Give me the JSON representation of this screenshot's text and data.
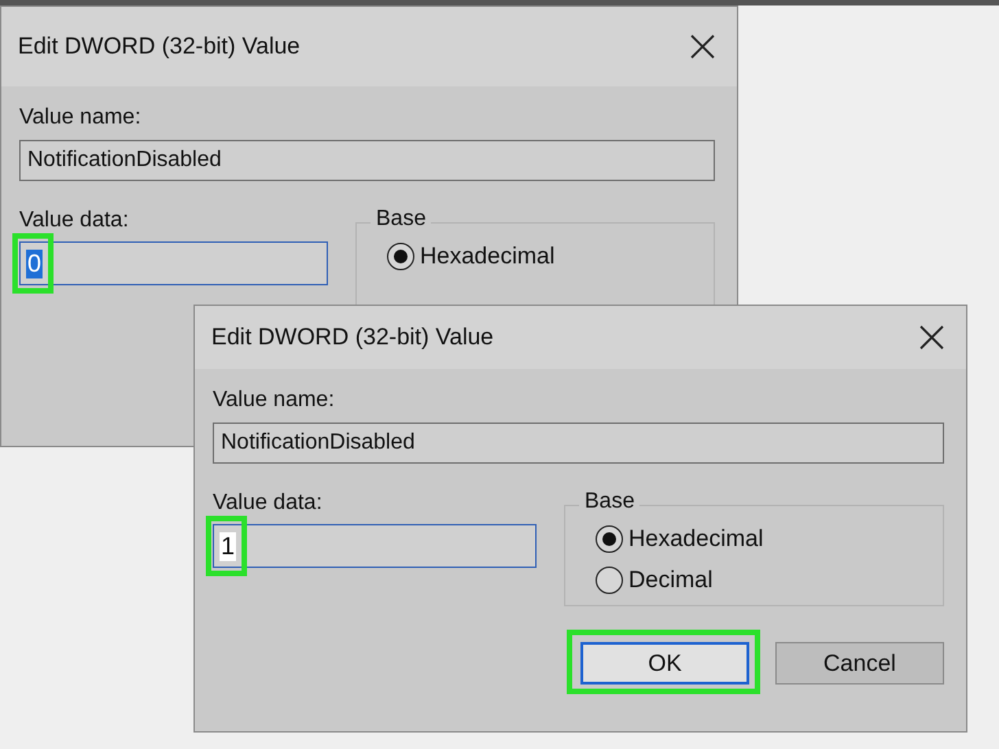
{
  "dialogs": [
    {
      "title": "Edit DWORD (32-bit) Value",
      "value_name_label": "Value name:",
      "value_name": "NotificationDisabled",
      "value_data_label": "Value data:",
      "value_data": "0",
      "value_data_selected": true,
      "value_highlighted": true,
      "base_label": "Base",
      "radios": [
        {
          "label": "Hexadecimal",
          "selected": true
        }
      ]
    },
    {
      "title": "Edit DWORD (32-bit) Value",
      "value_name_label": "Value name:",
      "value_name": "NotificationDisabled",
      "value_data_label": "Value data:",
      "value_data": "1",
      "value_data_selected": false,
      "value_highlighted": true,
      "base_label": "Base",
      "radios": [
        {
          "label": "Hexadecimal",
          "selected": true
        },
        {
          "label": "Decimal",
          "selected": false
        }
      ],
      "buttons": [
        {
          "label": "OK",
          "default": true,
          "highlighted": true
        },
        {
          "label": "Cancel",
          "default": false,
          "highlighted": false
        }
      ]
    }
  ]
}
